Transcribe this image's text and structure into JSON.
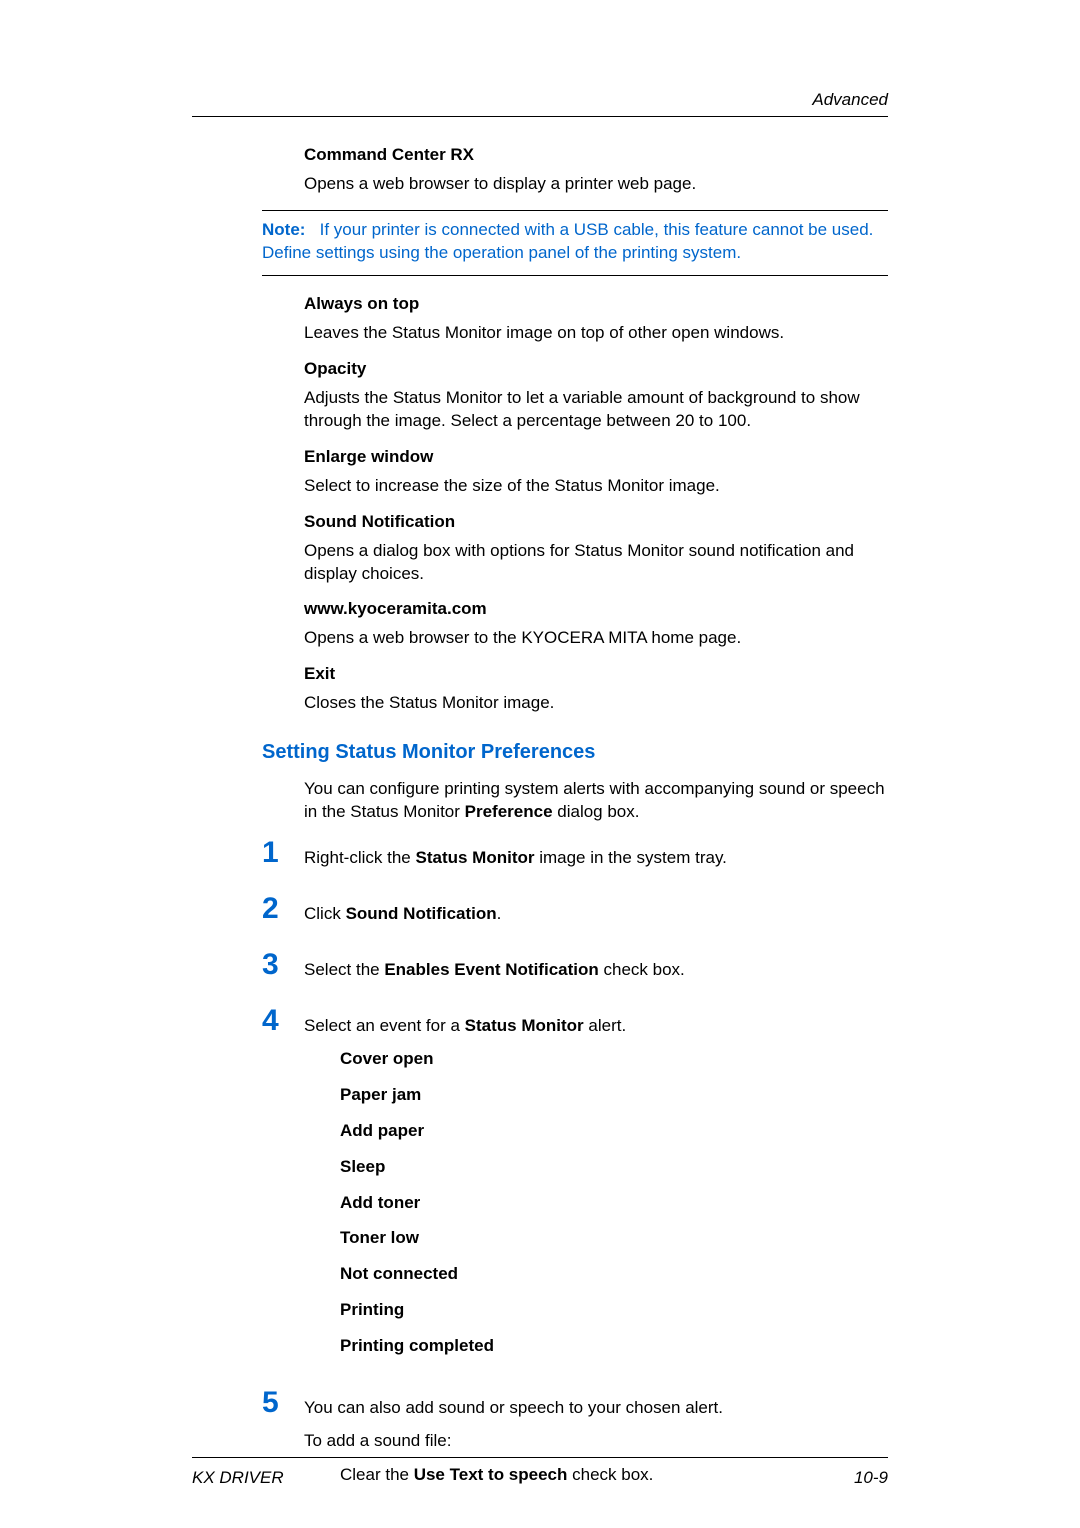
{
  "header": {
    "section_title": "Advanced"
  },
  "body": {
    "command_center": {
      "title": "Command Center RX",
      "desc": "Opens a web browser to display a printer web page."
    },
    "note": {
      "label": "Note:",
      "text": "If your printer is connected with a USB cable, this feature cannot be used. Define settings using the operation panel of the printing system."
    },
    "always_on_top": {
      "title": "Always on top",
      "desc": "Leaves the Status Monitor image on top of other open windows."
    },
    "opacity": {
      "title": "Opacity",
      "desc": "Adjusts the Status Monitor to let a variable amount of background to show through the image. Select a percentage between 20 to 100."
    },
    "enlarge": {
      "title": "Enlarge window",
      "desc": "Select to increase the size of the Status Monitor image."
    },
    "sound_notif": {
      "title": "Sound Notification",
      "desc": "Opens a dialog box with options for Status Monitor sound notification and display choices."
    },
    "website": {
      "title": "www.kyoceramita.com",
      "desc": "Opens a web browser to the KYOCERA MITA home page."
    },
    "exit": {
      "title": "Exit",
      "desc": "Closes the Status Monitor image."
    },
    "section_heading": "Setting Status Monitor Preferences",
    "section_intro_pre": "You can configure printing system alerts with accompanying sound or speech in the Status Monitor ",
    "section_intro_bold": "Preference",
    "section_intro_post": " dialog box.",
    "steps": {
      "s1": {
        "num": "1",
        "pre": "Right-click the ",
        "bold": "Status Monitor",
        "post": " image in the system tray."
      },
      "s2": {
        "num": "2",
        "pre": "Click ",
        "bold": "Sound Notification",
        "post": "."
      },
      "s3": {
        "num": "3",
        "pre": "Select the ",
        "bold": "Enables Event Notification",
        "post": " check box."
      },
      "s4": {
        "num": "4",
        "pre": "Select an event for a ",
        "bold": "Status Monitor",
        "post": " alert."
      },
      "s5": {
        "num": "5",
        "line1": "You can also add sound or speech to your chosen alert.",
        "line2": "To add a sound file:",
        "line3_pre": "Clear the ",
        "line3_bold": "Use Text to speech",
        "line3_post": " check box."
      }
    },
    "events": [
      "Cover open",
      "Paper jam",
      "Add paper",
      "Sleep",
      "Add toner",
      "Toner low",
      "Not connected",
      "Printing",
      "Printing completed"
    ]
  },
  "footer": {
    "left": "KX DRIVER",
    "right": "10-9"
  }
}
